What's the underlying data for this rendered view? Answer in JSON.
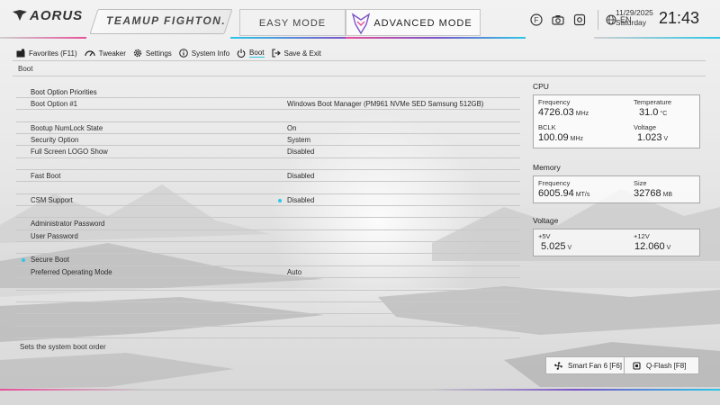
{
  "header": {
    "brand": "AORUS",
    "team": "TEAMUP FIGHTON.",
    "modes": {
      "easy": "EASY MODE",
      "advanced": "ADVANCED MODE"
    },
    "icons": [
      "help-icon",
      "screenshot-icon",
      "settings-icon",
      "globe-icon"
    ],
    "language": "EN",
    "date": "11/29/2025",
    "day": "Saturday",
    "time": "21:43"
  },
  "menu": [
    {
      "label": "Favorites (F11)",
      "icon": "favorites-icon"
    },
    {
      "label": "Tweaker",
      "icon": "speedometer-icon"
    },
    {
      "label": "Settings",
      "icon": "gear-icon"
    },
    {
      "label": "System Info",
      "icon": "info-icon"
    },
    {
      "label": "Boot",
      "icon": "power-icon",
      "active": true
    },
    {
      "label": "Save & Exit",
      "icon": "exit-icon"
    }
  ],
  "breadcrumb": "Boot",
  "settings": {
    "boot_option_priorities": "Boot Option Priorities",
    "boot_option_1": {
      "label": "Boot Option #1",
      "value": "Windows Boot Manager (PM961 NVMe SED Samsung 512GB)"
    },
    "numlock": {
      "label": "Bootup NumLock State",
      "value": "On"
    },
    "security_option": {
      "label": "Security Option",
      "value": "System"
    },
    "full_screen_logo": {
      "label": "Full Screen LOGO Show",
      "value": "Disabled"
    },
    "fast_boot": {
      "label": "Fast Boot",
      "value": "Disabled"
    },
    "csm_support": {
      "label": "CSM Support",
      "value": "Disabled"
    },
    "admin_password": "Administrator Password",
    "user_password": "User Password",
    "secure_boot": "Secure Boot",
    "preferred_mode": {
      "label": "Preferred Operating Mode",
      "value": "Auto"
    }
  },
  "help_text": "Sets the system boot order",
  "cpu": {
    "title": "CPU",
    "frequency": {
      "label": "Frequency",
      "value": "4726.03",
      "unit": "MHz"
    },
    "temperature": {
      "label": "Temperature",
      "value": "31.0",
      "unit": "°C"
    },
    "bclk": {
      "label": "BCLK",
      "value": "100.09",
      "unit": "MHz"
    },
    "voltage": {
      "label": "Voltage",
      "value": "1.023",
      "unit": "V"
    }
  },
  "memory": {
    "title": "Memory",
    "frequency": {
      "label": "Frequency",
      "value": "6005.94",
      "unit": "MT/s"
    },
    "size": {
      "label": "Size",
      "value": "32768",
      "unit": "MB"
    }
  },
  "voltage": {
    "title": "Voltage",
    "v5": {
      "label": "+5V",
      "value": "5.025",
      "unit": "V"
    },
    "v12": {
      "label": "+12V",
      "value": "12.060",
      "unit": "V"
    }
  },
  "bottom": {
    "smart_fan": "Smart Fan 6 [F6]",
    "qflash": "Q-Flash [F8]"
  },
  "colors": {
    "accent_cyan": "#2ec6e8",
    "accent_pink": "#e7509a",
    "accent_purple": "#7a55c8"
  }
}
